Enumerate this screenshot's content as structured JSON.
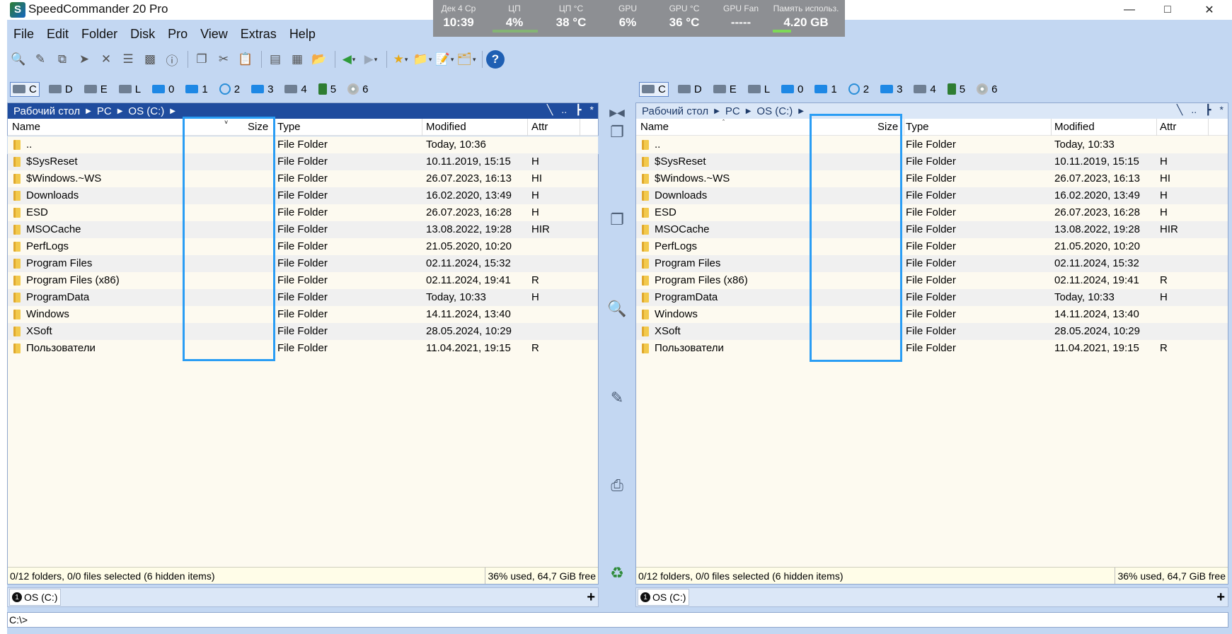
{
  "window": {
    "title": "SpeedCommander 20 Pro",
    "logo_letter": "S"
  },
  "sysmon": [
    {
      "label": "Дек 4  Ср",
      "value": "10:39"
    },
    {
      "label": "ЦП",
      "value": "4%"
    },
    {
      "label": "ЦП °C",
      "value": "38 °C"
    },
    {
      "label": "GPU",
      "value": "6%"
    },
    {
      "label": "GPU °C",
      "value": "36 °C"
    },
    {
      "label": "GPU Fan",
      "value": "-----"
    },
    {
      "label": "Память использ.",
      "value": "4.20 GB"
    }
  ],
  "menu": [
    "File",
    "Edit",
    "Folder",
    "Disk",
    "Pro",
    "View",
    "Extras",
    "Help"
  ],
  "toolbar": {
    "help_label": "?"
  },
  "drives": [
    "C",
    "D",
    "E",
    "L",
    "0",
    "1",
    "2",
    "3",
    "4",
    "5",
    "6"
  ],
  "columns": {
    "name": "Name",
    "size": "Size",
    "type": "Type",
    "modified": "Modified",
    "attr": "Attr"
  },
  "left": {
    "path": [
      "Рабочий стол",
      "PC",
      "OS (C:)"
    ],
    "rows": [
      {
        "name": "..",
        "size": "",
        "type": "File Folder",
        "modified": "Today, 10:36",
        "attr": ""
      },
      {
        "name": "$SysReset",
        "size": "",
        "type": "File Folder",
        "modified": "10.11.2019, 15:15",
        "attr": "H"
      },
      {
        "name": "$Windows.~WS",
        "size": "",
        "type": "File Folder",
        "modified": "26.07.2023, 16:13",
        "attr": "HI"
      },
      {
        "name": "Downloads",
        "size": "",
        "type": "File Folder",
        "modified": "16.02.2020, 13:49",
        "attr": "H"
      },
      {
        "name": "ESD",
        "size": "",
        "type": "File Folder",
        "modified": "26.07.2023, 16:28",
        "attr": "H"
      },
      {
        "name": "MSOCache",
        "size": "",
        "type": "File Folder",
        "modified": "13.08.2022, 19:28",
        "attr": "HIR"
      },
      {
        "name": "PerfLogs",
        "size": "",
        "type": "File Folder",
        "modified": "21.05.2020, 10:20",
        "attr": ""
      },
      {
        "name": "Program Files",
        "size": "",
        "type": "File Folder",
        "modified": "02.11.2024, 15:32",
        "attr": ""
      },
      {
        "name": "Program Files (x86)",
        "size": "",
        "type": "File Folder",
        "modified": "02.11.2024, 19:41",
        "attr": "R"
      },
      {
        "name": "ProgramData",
        "size": "",
        "type": "File Folder",
        "modified": "Today, 10:33",
        "attr": "H"
      },
      {
        "name": "Windows",
        "size": "",
        "type": "File Folder",
        "modified": "14.11.2024, 13:40",
        "attr": ""
      },
      {
        "name": "XSoft",
        "size": "",
        "type": "File Folder",
        "modified": "28.05.2024, 10:29",
        "attr": ""
      },
      {
        "name": "Пользователи",
        "size": "",
        "type": "File Folder",
        "modified": "11.04.2021, 19:15",
        "attr": "R"
      }
    ],
    "status_selection": "0/12 folders, 0/0 files selected (6 hidden items)",
    "status_free": "36% used, 64,7 GiB free",
    "tab_label": "OS (C:)",
    "tab_number": "1"
  },
  "right": {
    "path": [
      "Рабочий стол",
      "PC",
      "OS (C:)"
    ],
    "rows": [
      {
        "name": "..",
        "size": "",
        "type": "File Folder",
        "modified": "Today, 10:33",
        "attr": ""
      },
      {
        "name": "$SysReset",
        "size": "",
        "type": "File Folder",
        "modified": "10.11.2019, 15:15",
        "attr": "H"
      },
      {
        "name": "$Windows.~WS",
        "size": "",
        "type": "File Folder",
        "modified": "26.07.2023, 16:13",
        "attr": "HI"
      },
      {
        "name": "Downloads",
        "size": "",
        "type": "File Folder",
        "modified": "16.02.2020, 13:49",
        "attr": "H"
      },
      {
        "name": "ESD",
        "size": "",
        "type": "File Folder",
        "modified": "26.07.2023, 16:28",
        "attr": "H"
      },
      {
        "name": "MSOCache",
        "size": "",
        "type": "File Folder",
        "modified": "13.08.2022, 19:28",
        "attr": "HIR"
      },
      {
        "name": "PerfLogs",
        "size": "",
        "type": "File Folder",
        "modified": "21.05.2020, 10:20",
        "attr": ""
      },
      {
        "name": "Program Files",
        "size": "",
        "type": "File Folder",
        "modified": "02.11.2024, 15:32",
        "attr": ""
      },
      {
        "name": "Program Files (x86)",
        "size": "",
        "type": "File Folder",
        "modified": "02.11.2024, 19:41",
        "attr": "R"
      },
      {
        "name": "ProgramData",
        "size": "",
        "type": "File Folder",
        "modified": "Today, 10:33",
        "attr": "H"
      },
      {
        "name": "Windows",
        "size": "",
        "type": "File Folder",
        "modified": "14.11.2024, 13:40",
        "attr": ""
      },
      {
        "name": "XSoft",
        "size": "",
        "type": "File Folder",
        "modified": "28.05.2024, 10:29",
        "attr": ""
      },
      {
        "name": "Пользователи",
        "size": "",
        "type": "File Folder",
        "modified": "11.04.2021, 19:15",
        "attr": "R"
      }
    ],
    "status_selection": "0/12 folders, 0/0 files selected (6 hidden items)",
    "status_free": "36% used, 64,7 GiB free",
    "tab_label": "OS (C:)",
    "tab_number": "1"
  },
  "cmdline": "C:\\>",
  "colors": {
    "accent": "#1f4c9e",
    "frame": "#c3d7f2",
    "highlight_box": "#2a9df4",
    "panel_bg": "#fdfaf0"
  }
}
